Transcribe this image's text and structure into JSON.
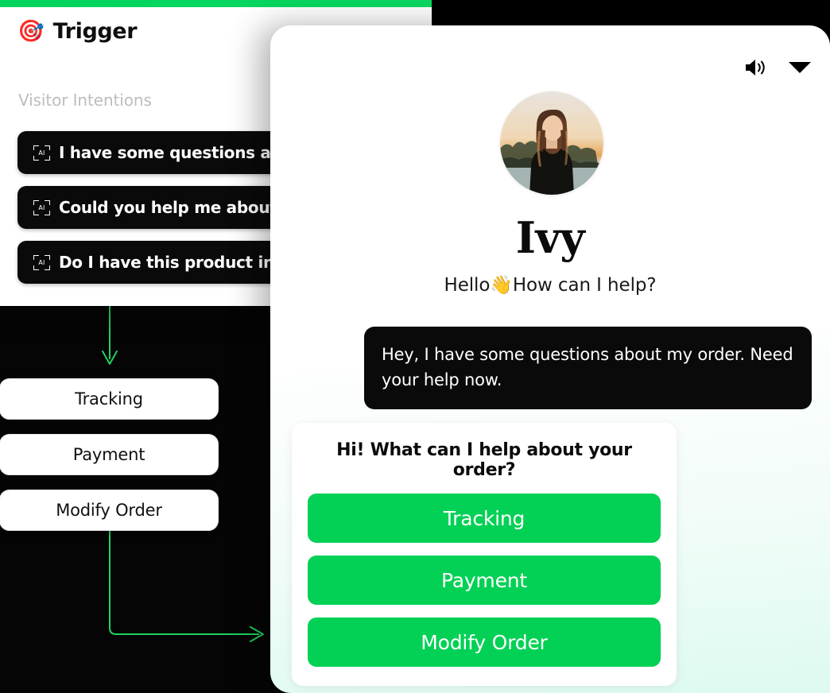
{
  "colors": {
    "accent_green": "#02d155",
    "top_bar_green": "#00d45c",
    "flow_arrow_green": "#1fd15f",
    "panel_background": "#000000",
    "pill_black": "#0a0a0a",
    "muted_label": "#bdbdbd"
  },
  "trigger_card": {
    "icon": "dart-target-emoji",
    "icon_glyph": "🎯",
    "title": "Trigger",
    "section_label": "Visitor Intentions",
    "intentions": [
      {
        "badge": "AI",
        "text": "I have some questions about my order"
      },
      {
        "badge": "AI",
        "text": "Could you help me about my order"
      },
      {
        "badge": "AI",
        "text": "Do I have this product in stock"
      }
    ]
  },
  "flow": {
    "nodes": [
      {
        "label": "Tracking"
      },
      {
        "label": "Payment"
      },
      {
        "label": "Modify Order"
      }
    ],
    "connector_icons": [
      "arrow-down-icon",
      "arrow-right-icon"
    ]
  },
  "chat_panel": {
    "header": {
      "speaker_icon": "speaker-volume-icon",
      "collapse_icon": "chevron-down-icon"
    },
    "avatar": {
      "name": "agent-avatar",
      "alt": "Portrait of a woman at sunset"
    },
    "agent_name": "Ivy",
    "greeting": "Hello👋How can I help?",
    "messages": [
      {
        "sender": "user",
        "text": "Hey, I have some questions about my order. Need your help now."
      }
    ],
    "bot_card": {
      "title": "Hi! What can I help about your order?",
      "options": [
        {
          "label": "Tracking"
        },
        {
          "label": "Payment"
        },
        {
          "label": "Modify Order"
        }
      ]
    }
  }
}
